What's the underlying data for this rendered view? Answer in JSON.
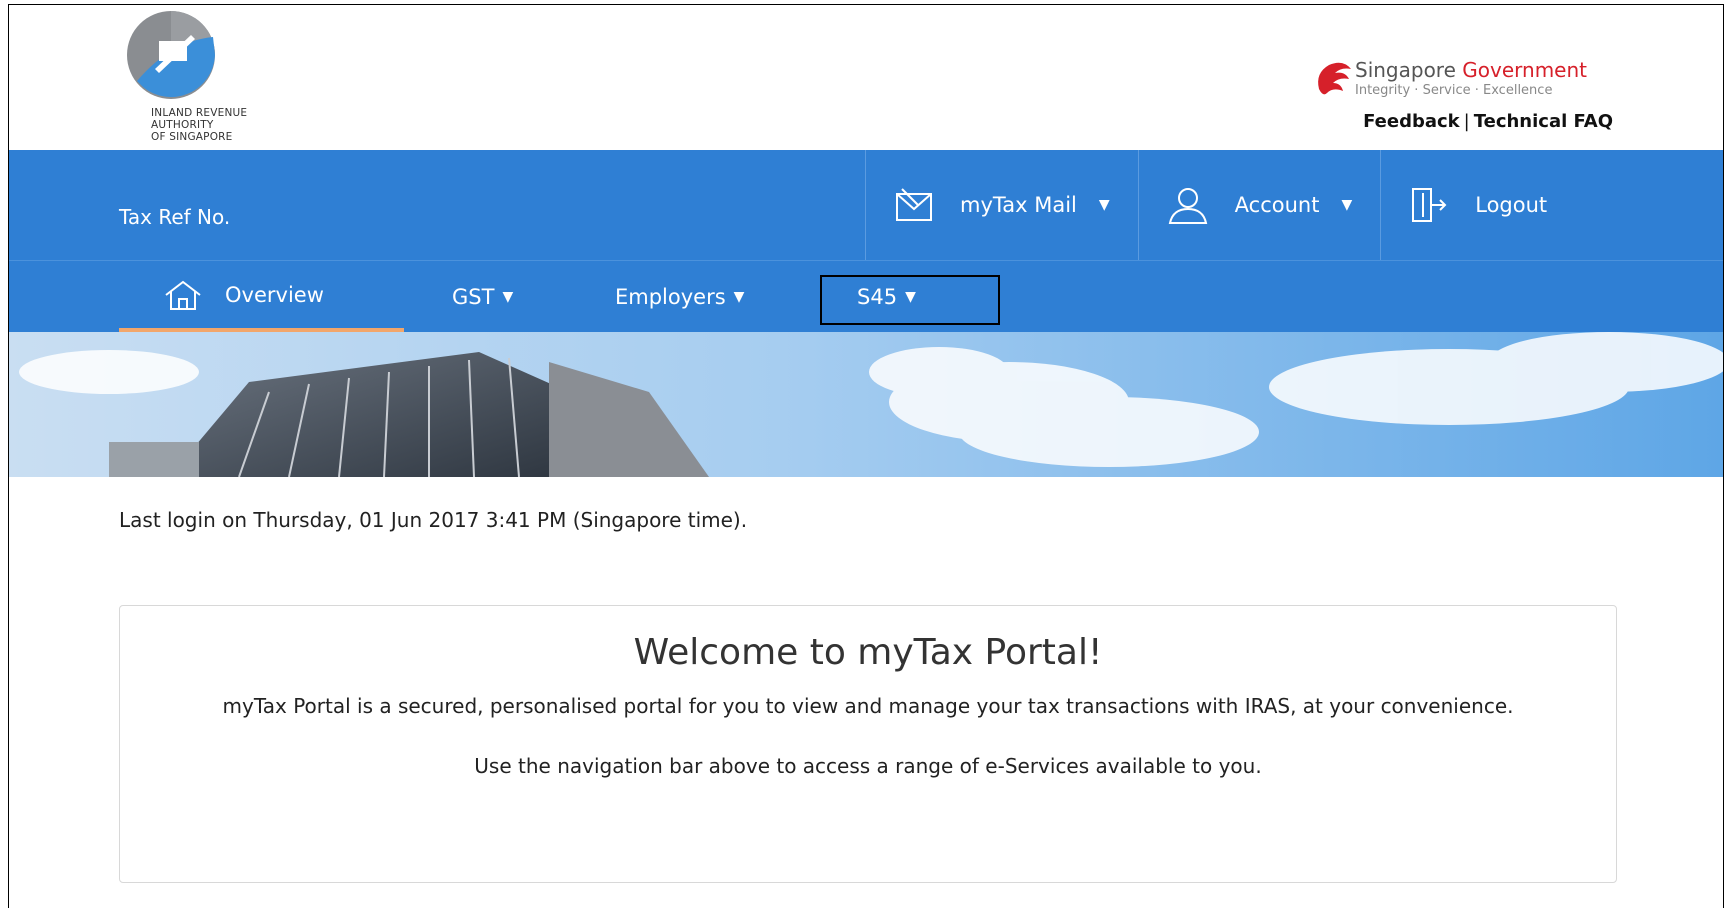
{
  "header": {
    "logo_text": "INLAND REVENUE\nAUTHORITY\nOF SINGAPORE",
    "gov_title_a": "Singapore ",
    "gov_title_b": "Government",
    "gov_tagline": "Integrity · Service · Excellence",
    "feedback": "Feedback",
    "link_sep": "|",
    "technical_faq": "Technical FAQ"
  },
  "topbar": {
    "tax_ref_label": "Tax Ref No.",
    "mail": "myTax Mail",
    "account": "Account",
    "logout": "Logout"
  },
  "nav": {
    "overview": "Overview",
    "gst": "GST",
    "employers": "Employers",
    "s45": "S45"
  },
  "status": {
    "last_login": "Last login on Thursday, 01 Jun 2017 3:41 PM (Singapore time)."
  },
  "welcome": {
    "title": "Welcome to myTax Portal!",
    "desc": "myTax Portal is a secured, personalised portal for you to view and manage your tax transactions with IRAS, at your convenience.",
    "hint": "Use the navigation bar above to access a range of e-Services available to you."
  },
  "colors": {
    "brand_blue": "#2f7fd4",
    "active_underline": "#f2a66b",
    "gov_red": "#d6202a"
  },
  "icons": [
    "iras-logo",
    "lion-head-icon",
    "mail-icon",
    "user-icon",
    "logout-icon",
    "home-icon"
  ]
}
